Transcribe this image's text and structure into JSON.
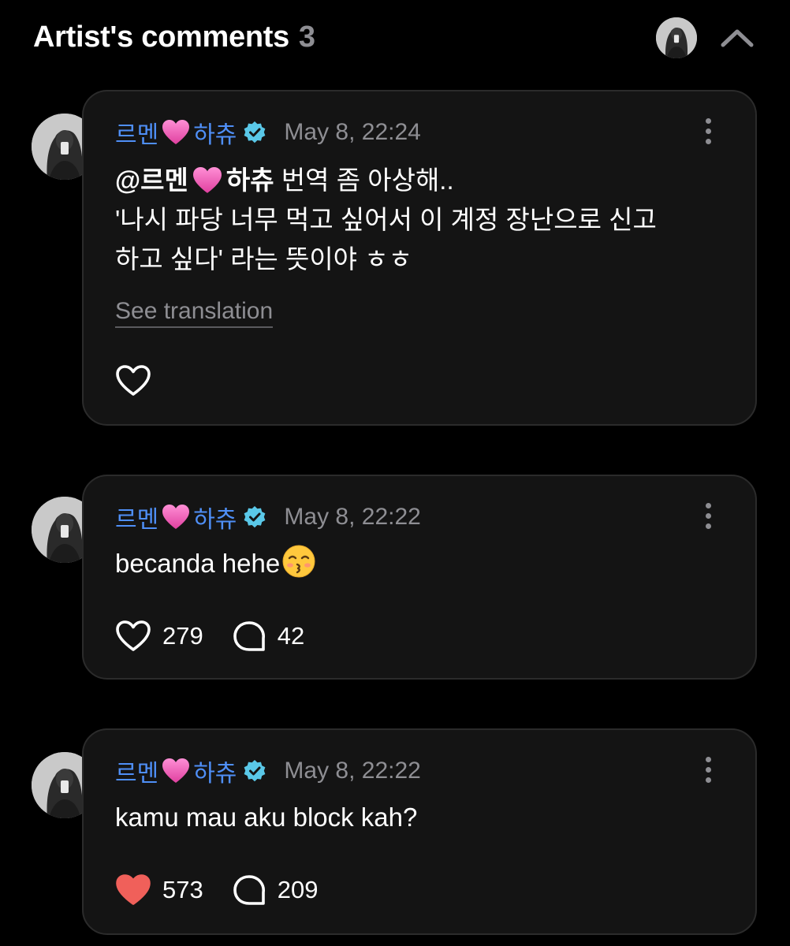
{
  "header": {
    "title": "Artist's comments",
    "count": "3"
  },
  "colors": {
    "author": "#4f8ff7",
    "liked_heart": "#f0605a",
    "verified_badge": "#5ac8e8",
    "card_background": "#141414"
  },
  "comments": [
    {
      "author_prefix": "르멘",
      "author_suffix": "하츄",
      "author_emoji": "pink-heart",
      "verified": true,
      "timestamp": "May 8, 22:24",
      "mention_prefix": "@르멘",
      "mention_suffix": "하츄",
      "text_line1_rest": " 번역 좀 아상해..",
      "text_line2": "'나시 파당 너무 먹고 싶어서 이 계정 장난으로 신고",
      "text_line3": "하고 싶다' 라는 뜻이야 ㅎㅎ",
      "see_translation": "See translation",
      "liked": false
    },
    {
      "author_prefix": "르멘",
      "author_suffix": "하츄",
      "author_emoji": "pink-heart",
      "verified": true,
      "timestamp": "May 8, 22:22",
      "text": "becanda hehe",
      "text_emoji": "kissing-face-closed-eyes",
      "likes": "279",
      "replies": "42",
      "liked": false
    },
    {
      "author_prefix": "르멘",
      "author_suffix": "하츄",
      "author_emoji": "pink-heart",
      "verified": true,
      "timestamp": "May 8, 22:22",
      "text": "kamu mau aku block kah?",
      "likes": "573",
      "replies": "209",
      "liked": true
    }
  ],
  "icons": {
    "collapse": "chevron-up-icon",
    "more": "more-vertical-icon",
    "like": "heart-icon",
    "reply": "reply-bubble-icon",
    "verified": "verified-badge-icon"
  }
}
